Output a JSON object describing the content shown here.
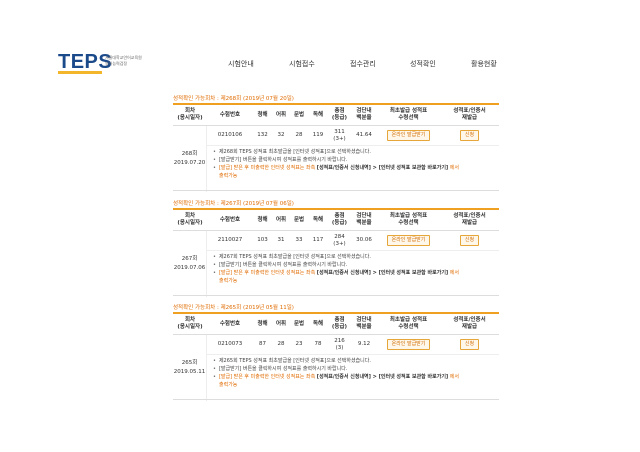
{
  "header": {
    "logo_text": "TEPS",
    "logo_sub": "서울대학교언어교육원\n영어능력검정",
    "nav": [
      "시험안내",
      "시험접수",
      "접수관리",
      "성적확인",
      "활용현황"
    ]
  },
  "table_headers": {
    "round": "회차\n(응시일자)",
    "exam_no": "수험번호",
    "listening": "청해",
    "vocab": "어휘",
    "grammar": "문법",
    "reading": "독해",
    "total": "총점\n(등급)",
    "percentile": "검단내\n백분율",
    "first_report": "최초발급 성적표\n수령선택",
    "reissue": "성적표/인증서\n재발급"
  },
  "buttons": {
    "online": "온라인 발급받기",
    "apply": "신청"
  },
  "notes": {
    "line2": "[발급받기] 버튼을 클릭하시여 성적표를 출력하시기 바랍니다.",
    "line3_a": "[발급] 받은 후 미출력한 인터넷 성적표는 좌측",
    "line3_b": "[성적표/인증서 신청내역] > [인터넷 성적표 보관함 바로가기]",
    "line3_c": "에서",
    "line3_d": "출력가능"
  },
  "results": [
    {
      "title": "성적확인 가능회차 : 제268회 (2019년 07월 20일)",
      "round": "268회",
      "date": "2019.07.20",
      "exam_no": "0210106",
      "listening": "132",
      "vocab": "32",
      "grammar": "28",
      "reading": "119",
      "total": "311",
      "grade": "(3+)",
      "percentile": "41.64",
      "note1": "제268회 TEPS 성적표 최초발급을 [인터넷 성적표]으로 선택하셨습니다."
    },
    {
      "title": "성적확인 가능회차 : 제267회 (2019년 07월 06일)",
      "round": "267회",
      "date": "2019.07.06",
      "exam_no": "2110027",
      "listening": "103",
      "vocab": "31",
      "grammar": "33",
      "reading": "117",
      "total": "284",
      "grade": "(3+)",
      "percentile": "30.06",
      "note1": "제267회 TEPS 성적표 최초발급을 [인터넷 성적표]으로 선택하셨습니다."
    },
    {
      "title": "성적확인 가능회차 : 제265회 (2019년 05월 11일)",
      "round": "265회",
      "date": "2019.05.11",
      "exam_no": "0210073",
      "listening": "87",
      "vocab": "28",
      "grammar": "23",
      "reading": "78",
      "total": "216",
      "grade": "(3)",
      "percentile": "9.12",
      "note1": "제265회 TEPS 성적표 최초발급을 [인터넷 성적표]으로 선택하셨습니다."
    }
  ]
}
